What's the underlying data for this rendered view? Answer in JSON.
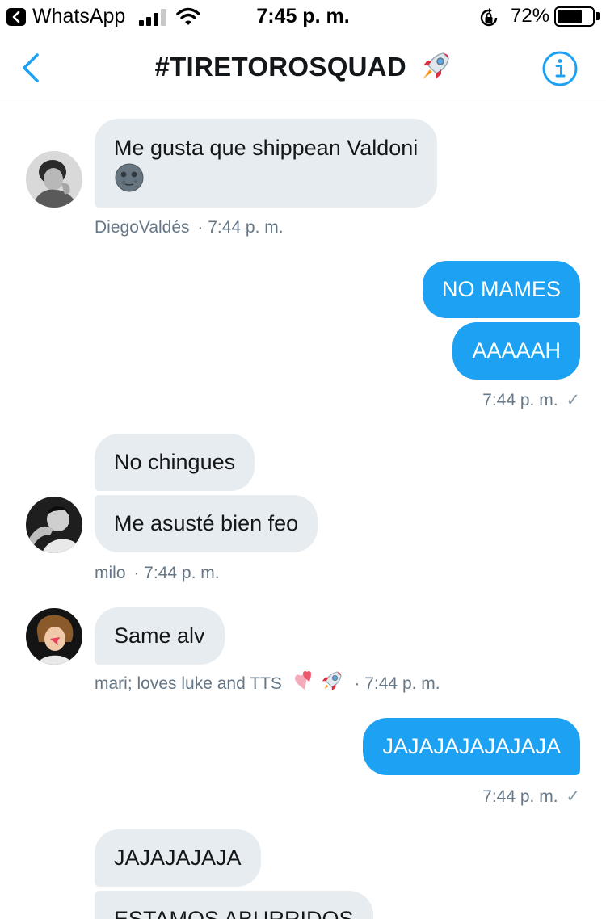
{
  "status_bar": {
    "back_app": "WhatsApp",
    "time": "7:45 p. m.",
    "battery_percent": "72%",
    "battery_level": 0.72,
    "icons": [
      "back-app-icon",
      "signal-icon",
      "wifi-icon",
      "rotation-lock-icon",
      "battery-icon"
    ]
  },
  "header": {
    "title": "#TIRETOROSQUAD",
    "title_emoji": "rocket-emoji",
    "back_icon": "chevron-left-icon",
    "info_icon": "info-icon"
  },
  "colors": {
    "accent": "#1da1f2",
    "incoming_bubble": "#e6ecf0",
    "meta_text": "#657786"
  },
  "messages": [
    {
      "side": "in",
      "text": "Me gusta que shippean Valdoni",
      "emoji": "new-moon-face-emoji"
    },
    {
      "side": "in_meta",
      "sender": "DiegoValdés",
      "time": "· 7:44 p. m."
    },
    {
      "side": "out",
      "text": "NO MAMES"
    },
    {
      "side": "out",
      "text": "AAAAAH"
    },
    {
      "side": "out_meta",
      "time": "7:44 p. m.",
      "status": "✓"
    },
    {
      "side": "in",
      "text": "No chingues"
    },
    {
      "side": "in",
      "text": "Me asusté bien feo"
    },
    {
      "side": "in_meta",
      "sender": "milo",
      "time": "· 7:44 p. m."
    },
    {
      "side": "in",
      "text": "Same alv"
    },
    {
      "side": "in_meta",
      "sender": "mari; loves luke and TTS",
      "sender_emojis": [
        "two-hearts-emoji",
        "rocket-emoji"
      ],
      "time": "· 7:44 p. m."
    },
    {
      "side": "out",
      "text": "JAJAJAJAJAJAJA"
    },
    {
      "side": "out_meta",
      "time": "7:44 p. m.",
      "status": "✓"
    },
    {
      "side": "in",
      "text": "JAJAJAJAJA"
    },
    {
      "side": "in",
      "text": "ESTAMOS ABURRIDOS"
    }
  ]
}
